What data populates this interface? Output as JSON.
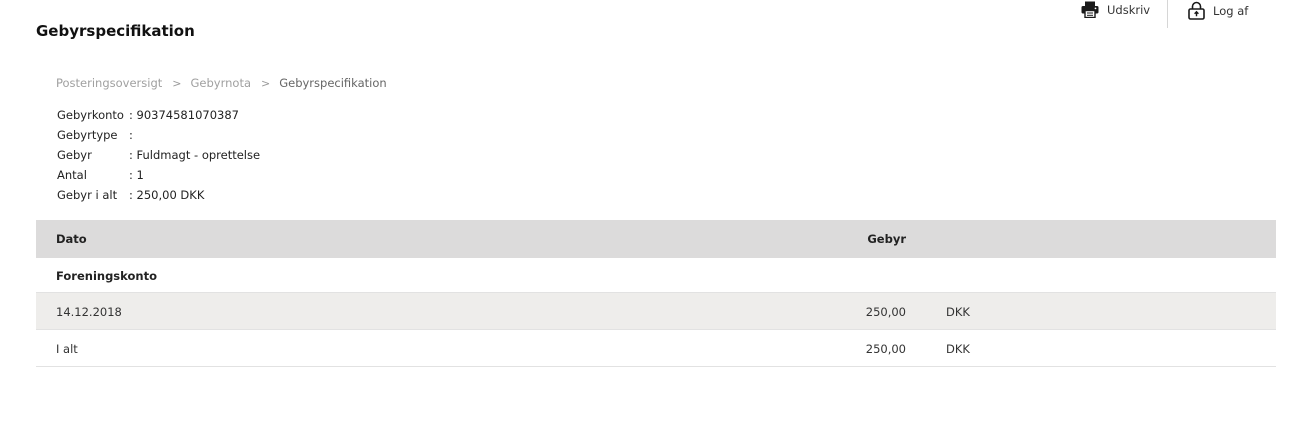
{
  "page": {
    "title": "Gebyrspecifikation"
  },
  "actions": {
    "print": {
      "label": "Udskriv",
      "icon": "printer-icon"
    },
    "logout": {
      "label": "Log af",
      "icon": "lock-icon"
    }
  },
  "breadcrumb": {
    "items": [
      "Posteringsoversigt",
      "Gebyrnota"
    ],
    "current": "Gebyrspecifikation",
    "separator": ">"
  },
  "details": [
    {
      "label": "Gebyrkonto",
      "value": ": 90374581070387"
    },
    {
      "label": "Gebyrtype",
      "value": ":"
    },
    {
      "label": "Gebyr",
      "value": ": Fuldmagt - oprettelse"
    },
    {
      "label": "Antal",
      "value": ": 1"
    },
    {
      "label": "Gebyr i alt",
      "value": ": 250,00 DKK"
    }
  ],
  "table": {
    "headers": {
      "date": "Dato",
      "fee": "Gebyr"
    },
    "group": "Foreningskonto",
    "rows": [
      {
        "date": "14.12.2018",
        "amount": "250,00",
        "currency": "DKK"
      }
    ],
    "total": {
      "label": "I alt",
      "amount": "250,00",
      "currency": "DKK"
    }
  },
  "colors": {
    "header_bg": "#dcdbdb",
    "row_shade": "#eeedeb",
    "breadcrumb_link": "#a0a0a0"
  }
}
